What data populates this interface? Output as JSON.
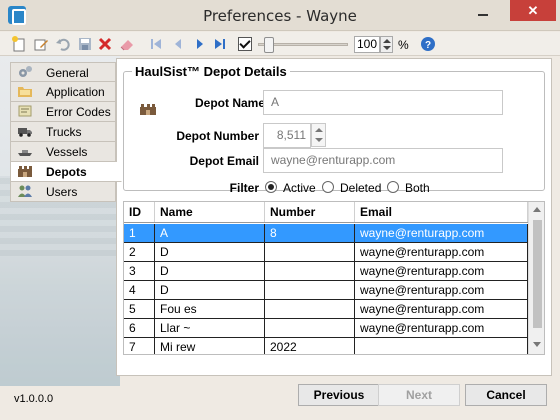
{
  "window": {
    "title": "Preferences - Wayne",
    "close_glyph": "✕"
  },
  "toolbar": {
    "icons": [
      "new-icon",
      "edit-icon",
      "undo-icon",
      "save-icon",
      "delete-icon",
      "eraser-icon",
      "first-record-icon",
      "previous-record-icon",
      "next-record-icon",
      "last-record-icon",
      "help-icon"
    ],
    "zoom_enabled": true,
    "zoom_value": "100",
    "zoom_unit": "%"
  },
  "nav": {
    "items": [
      {
        "label": "General",
        "icon": "gears-icon"
      },
      {
        "label": "Application",
        "icon": "folder-icon"
      },
      {
        "label": "Error Codes",
        "icon": "error-codes-icon"
      },
      {
        "label": "Trucks",
        "icon": "truck-icon"
      },
      {
        "label": "Vessels",
        "icon": "vessel-icon"
      },
      {
        "label": "Depots",
        "icon": "depot-icon",
        "active": true
      },
      {
        "label": "Users",
        "icon": "users-icon"
      }
    ]
  },
  "details": {
    "title": "HaulSist™ Depot Details",
    "depot_name_label": "Depot Name",
    "depot_name_value": "A",
    "depot_number_label": "Depot Number",
    "depot_number_value": "8,511",
    "depot_email_label": "Depot Email",
    "depot_email_value": "wayne@renturapp.com",
    "filter_label": "Filter",
    "filter_options": [
      "Active",
      "Deleted",
      "Both"
    ],
    "filter_selected": "Active"
  },
  "grid": {
    "columns": [
      "ID",
      "Name",
      "Number",
      "Email"
    ],
    "rows": [
      {
        "id": "1",
        "name": "A",
        "number": "8",
        "email": "wayne@renturapp.com",
        "selected": true
      },
      {
        "id": "2",
        "name": "D",
        "number": "",
        "email": "wayne@renturapp.com"
      },
      {
        "id": "3",
        "name": "D",
        "number": "",
        "email": "wayne@renturapp.com"
      },
      {
        "id": "4",
        "name": "D",
        "number": "",
        "email": "wayne@renturapp.com"
      },
      {
        "id": "5",
        "name": "Fou              es",
        "number": "",
        "email": "wayne@renturapp.com"
      },
      {
        "id": "6",
        "name": "Llar        ~",
        "number": "",
        "email": "wayne@renturapp.com"
      },
      {
        "id": "7",
        "name": "Mi                   rew",
        "number": "2022",
        "email": ""
      }
    ]
  },
  "footer": {
    "version": "v1.0.0.0",
    "previous_label": "Previous",
    "next_label": "Next",
    "cancel_label": "Cancel"
  },
  "colors": {
    "selection": "#3399ff",
    "close_button": "#c7403a",
    "help": "#2f6fc7"
  }
}
